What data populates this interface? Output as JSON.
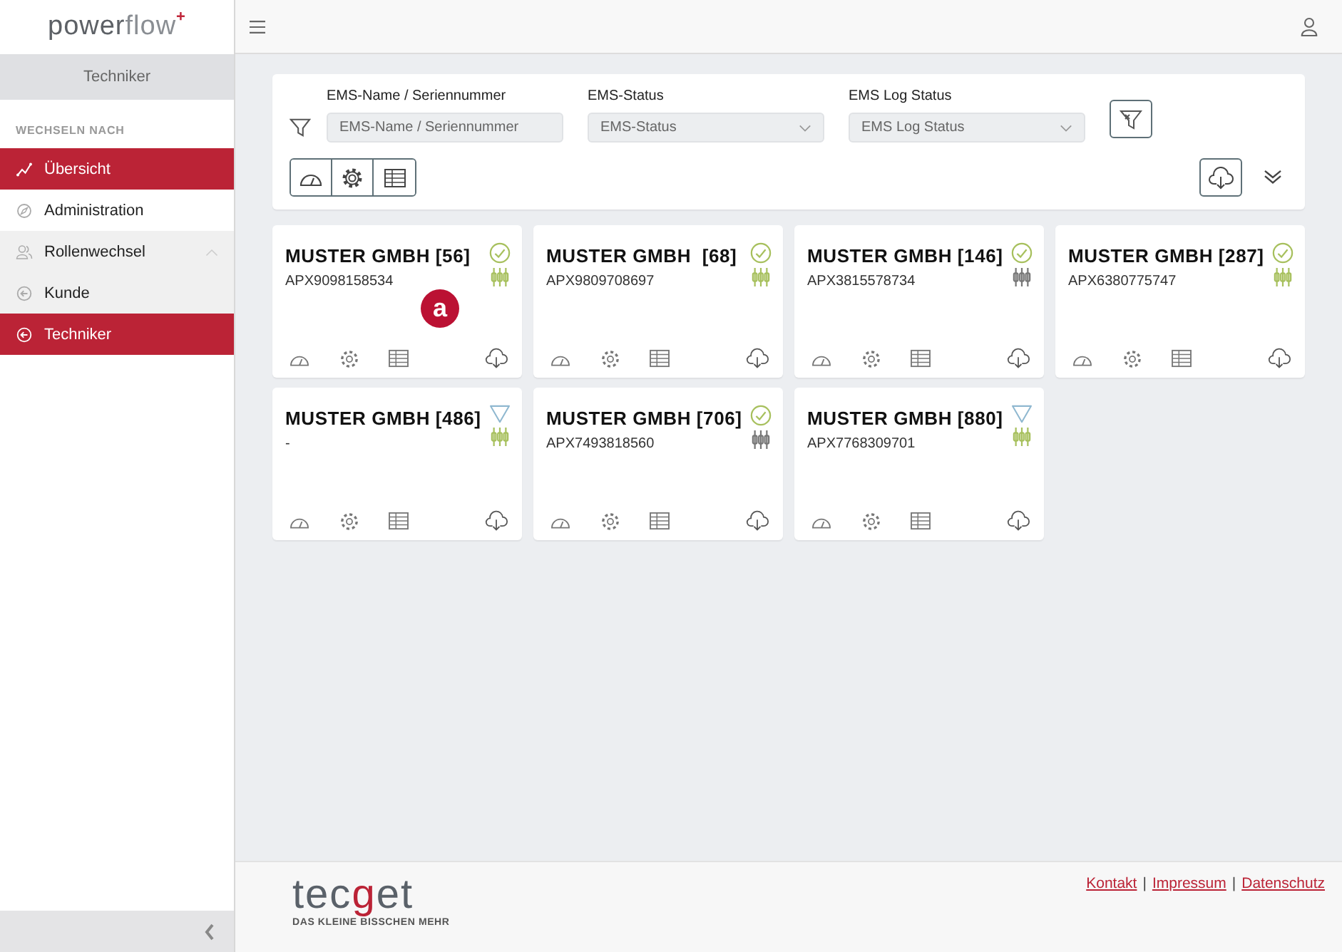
{
  "logo": {
    "main": "power",
    "accent": "flow",
    "mark": "+"
  },
  "sidebar": {
    "role": "Techniker",
    "section": "WECHSELN NACH",
    "items": [
      {
        "label": "Übersicht",
        "kind": "chart",
        "selected": true
      },
      {
        "label": "Administration",
        "kind": "admin",
        "selected": false
      },
      {
        "label": "Rollenwechsel",
        "kind": "users",
        "selected": false,
        "expanded": true,
        "children": [
          {
            "label": "Kunde",
            "selected": false
          },
          {
            "label": "Techniker",
            "selected": true
          }
        ]
      }
    ]
  },
  "filters": [
    {
      "label": "EMS-Name / Seriennummer",
      "kind": "text",
      "placeholder": "EMS-Name / Seriennummer"
    },
    {
      "label": "EMS-Status",
      "kind": "select",
      "placeholder": "EMS-Status"
    },
    {
      "label": "EMS Log Status",
      "kind": "select",
      "placeholder": "EMS Log Status"
    }
  ],
  "annotation": "a",
  "cards": [
    {
      "title": "MUSTER GMBH [56]",
      "serial": "APX9098158534",
      "status_ok": true,
      "log_ok": true
    },
    {
      "title": "MUSTER GMBH  [68]",
      "serial": "APX9809708697",
      "status_ok": true,
      "log_ok": true
    },
    {
      "title": "MUSTER GMBH [146]",
      "serial": "APX3815578734",
      "status_ok": true,
      "log_ok": false
    },
    {
      "title": "MUSTER GMBH [287]",
      "serial": "APX6380775747",
      "status_ok": true,
      "log_ok": true
    },
    {
      "title": "MUSTER GMBH [486]",
      "serial": "-",
      "status_ok": false,
      "log_ok": true
    },
    {
      "title": "MUSTER GMBH [706]",
      "serial": "APX7493818560",
      "status_ok": true,
      "log_ok": false
    },
    {
      "title": "MUSTER GMBH [880]",
      "serial": "APX7768309701",
      "status_ok": false,
      "log_ok": true
    }
  ],
  "footer": {
    "brand": {
      "start": "tec",
      "mark": "g",
      "end": "et"
    },
    "tagline": "DAS KLEINE BISSCHEN MEHR",
    "links": [
      "Kontakt",
      "Impressum",
      "Datenschutz"
    ],
    "separators": [
      "|",
      "|"
    ]
  }
}
